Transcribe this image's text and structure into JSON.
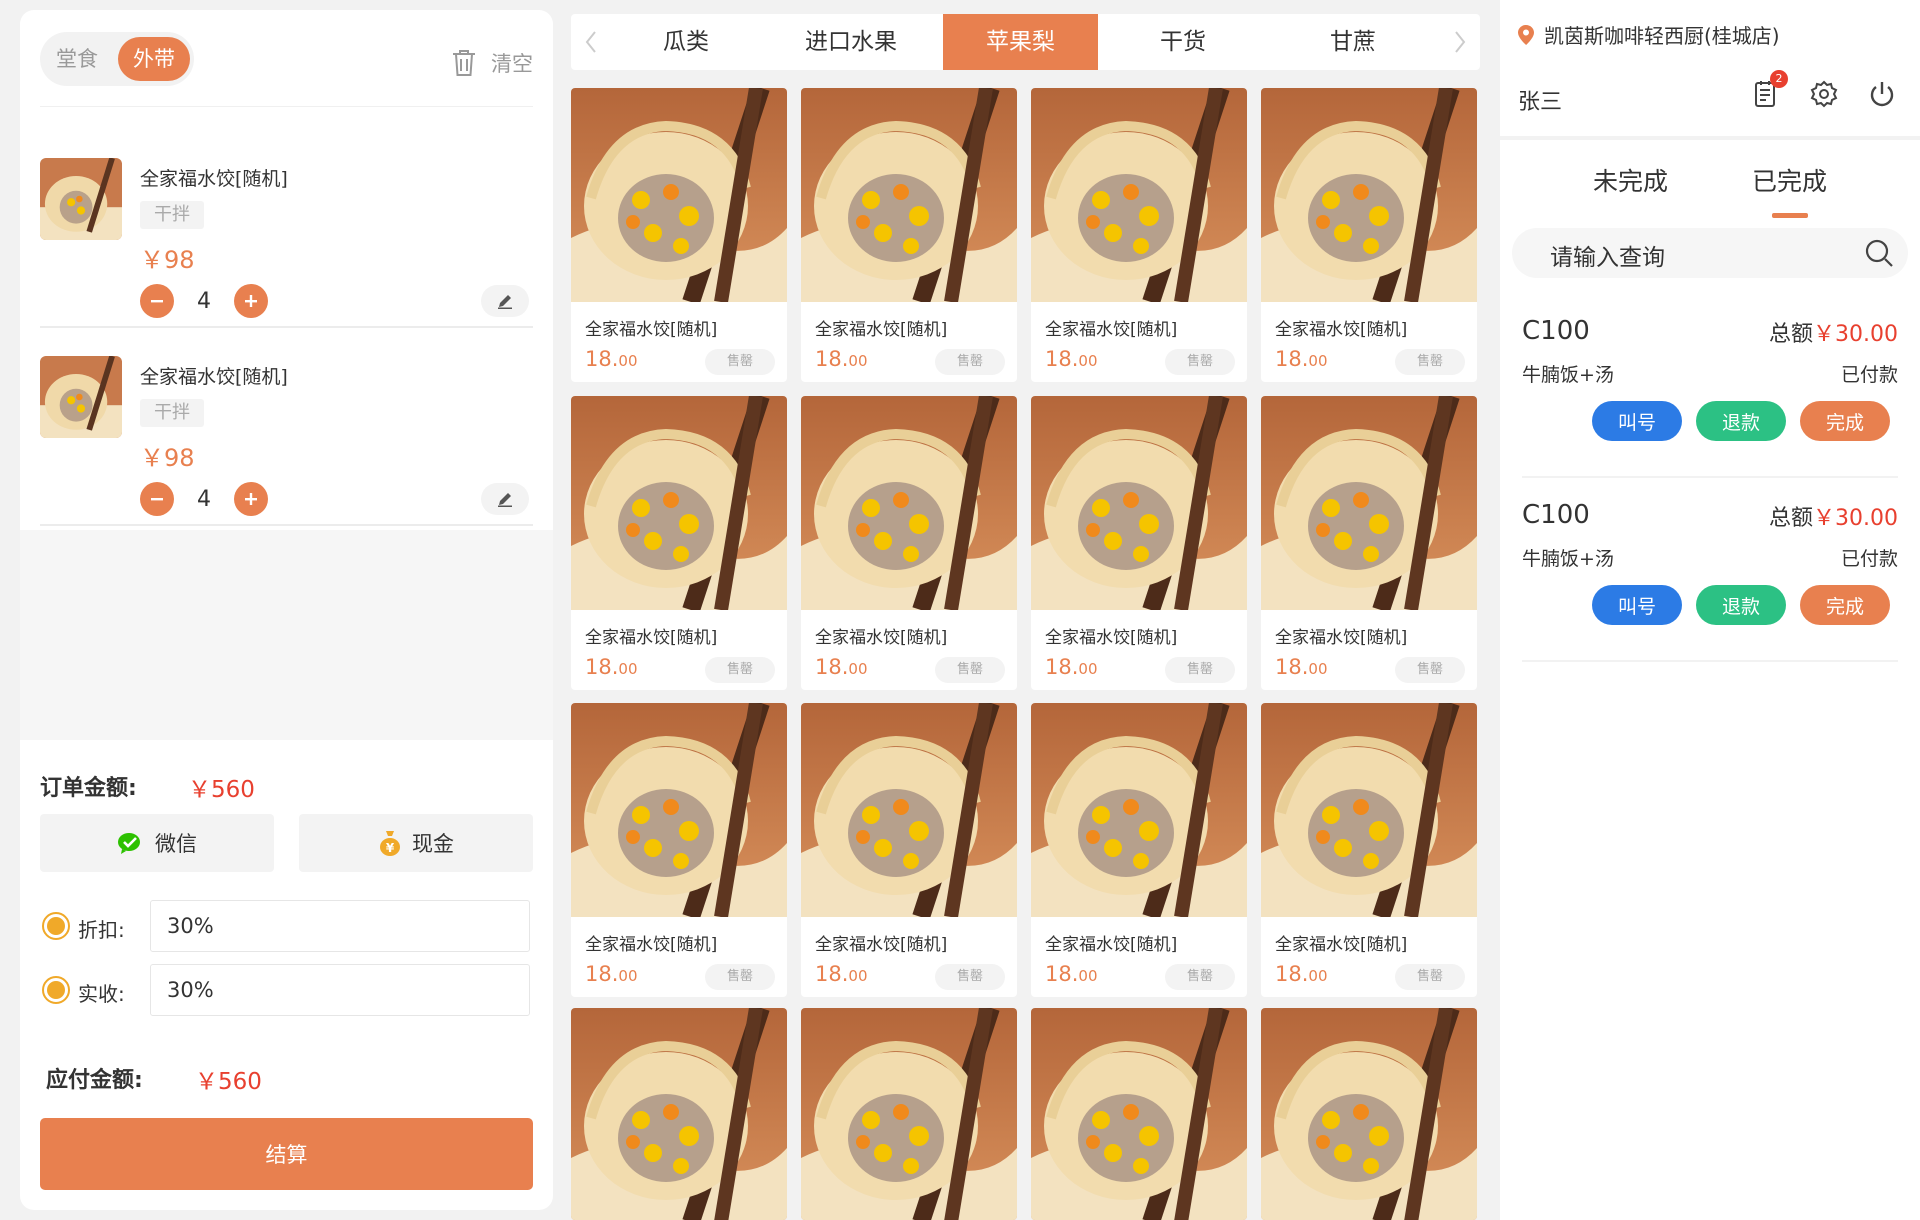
{
  "left": {
    "mode": {
      "dine_in": "堂食",
      "takeaway": "外带"
    },
    "clear_label": "清空",
    "cart_items": [
      {
        "name": "全家福水饺[随机]",
        "tag": "干拌",
        "price": "￥98",
        "qty": "4"
      },
      {
        "name": "全家福水饺[随机]",
        "tag": "干拌",
        "price": "￥98",
        "qty": "4"
      }
    ],
    "order_amount_label": "订单金额:",
    "order_amount": "￥560",
    "pay_wechat": "微信",
    "pay_cash": "现金",
    "discount_label": "折扣:",
    "discount_value": "30%",
    "received_label": "实收:",
    "received_value": "30%",
    "payable_label": "应付金额:",
    "payable_amount": "￥560",
    "checkout_label": "结算"
  },
  "categories": [
    "瓜类",
    "进口水果",
    "苹果梨",
    "干货",
    "甘蔗"
  ],
  "active_category": "苹果梨",
  "products": [
    {
      "name": "全家福水饺[随机]",
      "price_int": "18.",
      "price_dec": "00",
      "status": "售罄"
    },
    {
      "name": "全家福水饺[随机]",
      "price_int": "18.",
      "price_dec": "00",
      "status": "售罄"
    },
    {
      "name": "全家福水饺[随机]",
      "price_int": "18.",
      "price_dec": "00",
      "status": "售罄"
    },
    {
      "name": "全家福水饺[随机]",
      "price_int": "18.",
      "price_dec": "00",
      "status": "售罄"
    },
    {
      "name": "全家福水饺[随机]",
      "price_int": "18.",
      "price_dec": "00",
      "status": "售罄"
    },
    {
      "name": "全家福水饺[随机]",
      "price_int": "18.",
      "price_dec": "00",
      "status": "售罄"
    },
    {
      "name": "全家福水饺[随机]",
      "price_int": "18.",
      "price_dec": "00",
      "status": "售罄"
    },
    {
      "name": "全家福水饺[随机]",
      "price_int": "18.",
      "price_dec": "00",
      "status": "售罄"
    },
    {
      "name": "全家福水饺[随机]",
      "price_int": "18.",
      "price_dec": "00",
      "status": "售罄"
    },
    {
      "name": "全家福水饺[随机]",
      "price_int": "18.",
      "price_dec": "00",
      "status": "售罄"
    },
    {
      "name": "全家福水饺[随机]",
      "price_int": "18.",
      "price_dec": "00",
      "status": "售罄"
    },
    {
      "name": "全家福水饺[随机]",
      "price_int": "18.",
      "price_dec": "00",
      "status": "售罄"
    }
  ],
  "right": {
    "store_name": "凯茵斯咖啡轻西厨(桂城店)",
    "user_name": "张三",
    "notification_count": "2",
    "tabs": [
      "未完成",
      "已完成"
    ],
    "active_tab": "已完成",
    "search_placeholder": "请输入查询",
    "orders": [
      {
        "code": "C100",
        "total_label": "总额",
        "total": "￥30.00",
        "desc": "牛腩饭+汤",
        "status": "已付款",
        "call_label": "叫号",
        "refund_label": "退款",
        "done_label": "完成"
      },
      {
        "code": "C100",
        "total_label": "总额",
        "total": "￥30.00",
        "desc": "牛腩饭+汤",
        "status": "已付款",
        "call_label": "叫号",
        "refund_label": "退款",
        "done_label": "完成"
      }
    ]
  },
  "colors": {
    "accent": "#e8804f",
    "price_red": "#e8402f",
    "blue": "#2c7be5",
    "green": "#2cc184",
    "coin": "#f0a929",
    "wechat": "#2dc100"
  },
  "icons": {
    "clear": "trash-icon",
    "edit": "pencil-icon",
    "minus": "minus-icon",
    "plus": "plus-icon",
    "wechat": "wechat-icon",
    "cash": "money-bag-icon",
    "location": "location-pin-icon",
    "orders": "order-list-icon",
    "settings": "gear-icon",
    "power": "power-icon",
    "search": "search-icon"
  }
}
